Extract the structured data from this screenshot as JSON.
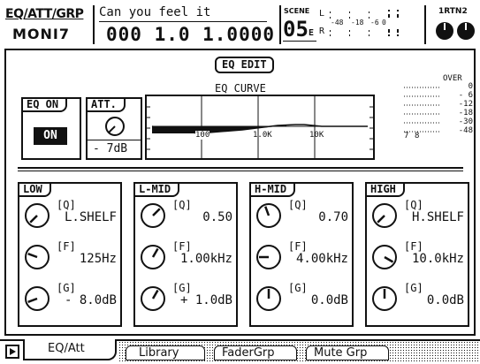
{
  "header": {
    "page_group": "EQ/ATT/GRP",
    "page_name": "MONI7",
    "song_title": "Can you feel it",
    "timecode": "000 1.0 1.0000",
    "scene_label": "SCENE",
    "scene_number": "05",
    "scene_suffix": "E",
    "meter_l": "L",
    "meter_r": "R",
    "meter_scale": [
      "-48",
      "-18",
      "-6",
      "0"
    ],
    "rtn_label": "1RTN2"
  },
  "eq_edit": {
    "title": "EQ EDIT",
    "eq_on_label": "EQ ON",
    "eq_on_state": "ON",
    "att_label": "ATT.",
    "att_value": "- 7dB",
    "curve_title": "EQ CURVE",
    "curve_freq_labels": [
      "100",
      "1.0K",
      "10K"
    ],
    "meter_over_label": "OVER",
    "meter_scale": [
      "0",
      "- 6",
      "-12",
      "-18",
      "-30",
      "-48"
    ],
    "meter_channels": [
      "7",
      "8"
    ]
  },
  "bands": [
    {
      "name": "LOW",
      "q_label": "[Q]",
      "q_value": "L.SHELF",
      "f_label": "[F]",
      "f_value": "125Hz",
      "g_label": "[G]",
      "g_value": "- 8.0dB"
    },
    {
      "name": "L-MID",
      "q_label": "[Q]",
      "q_value": "0.50",
      "f_label": "[F]",
      "f_value": "1.00kHz",
      "g_label": "[G]",
      "g_value": "+ 1.0dB"
    },
    {
      "name": "H-MID",
      "q_label": "[Q]",
      "q_value": "0.70",
      "f_label": "[F]",
      "f_value": "4.00kHz",
      "g_label": "[G]",
      "g_value": "0.0dB"
    },
    {
      "name": "HIGH",
      "q_label": "[Q]",
      "q_value": "H.SHELF",
      "f_label": "[F]",
      "f_value": "10.0kHz",
      "g_label": "[G]",
      "g_value": "0.0dB"
    }
  ],
  "tabs": [
    {
      "label": "EQ/Att",
      "active": true
    },
    {
      "label": "Library",
      "active": false
    },
    {
      "label": "FaderGrp",
      "active": false
    },
    {
      "label": "Mute Grp",
      "active": false
    }
  ],
  "icons": {
    "tab_arrow": "play-arrow-icon",
    "knob": "rotary-knob-icon"
  }
}
